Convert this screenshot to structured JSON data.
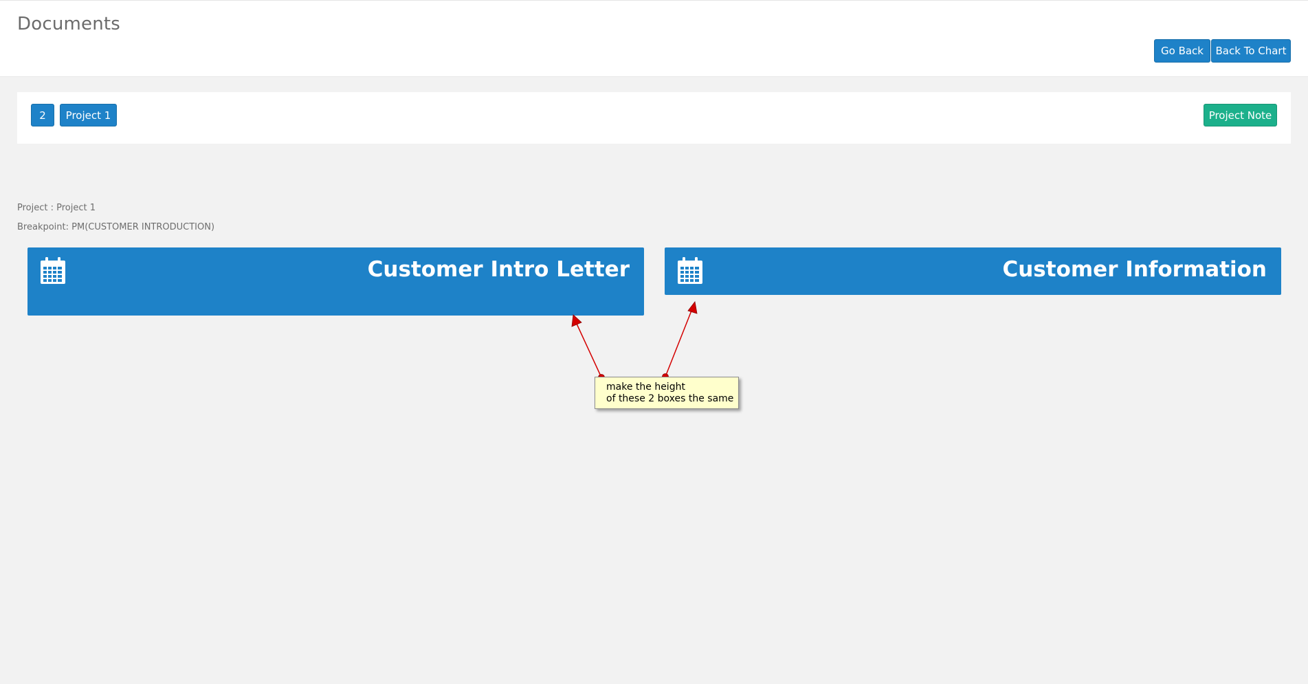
{
  "header": {
    "title": "Documents",
    "go_back_label": "Go Back",
    "back_to_chart_label": "Back To Chart"
  },
  "project_bar": {
    "number_label": "2",
    "project_label": "Project 1",
    "project_note_label": "Project Note"
  },
  "info": {
    "project_line": "Project : Project 1",
    "breakpoint_line": "Breakpoint: PM(CUSTOMER INTRODUCTION)"
  },
  "documents": [
    {
      "title": "Customer Intro Letter",
      "icon": "calendar-icon"
    },
    {
      "title": "Customer Information",
      "icon": "calendar-icon"
    }
  ],
  "annotation": {
    "line1": "make the height",
    "line2": "of these 2 boxes the same"
  },
  "colors": {
    "primary_button": "#1e82c8",
    "note_button": "#1cb08b",
    "annotation_arrow": "#d40000",
    "annotation_note_bg": "#ffffcc",
    "page_background": "#f2f2f2"
  }
}
